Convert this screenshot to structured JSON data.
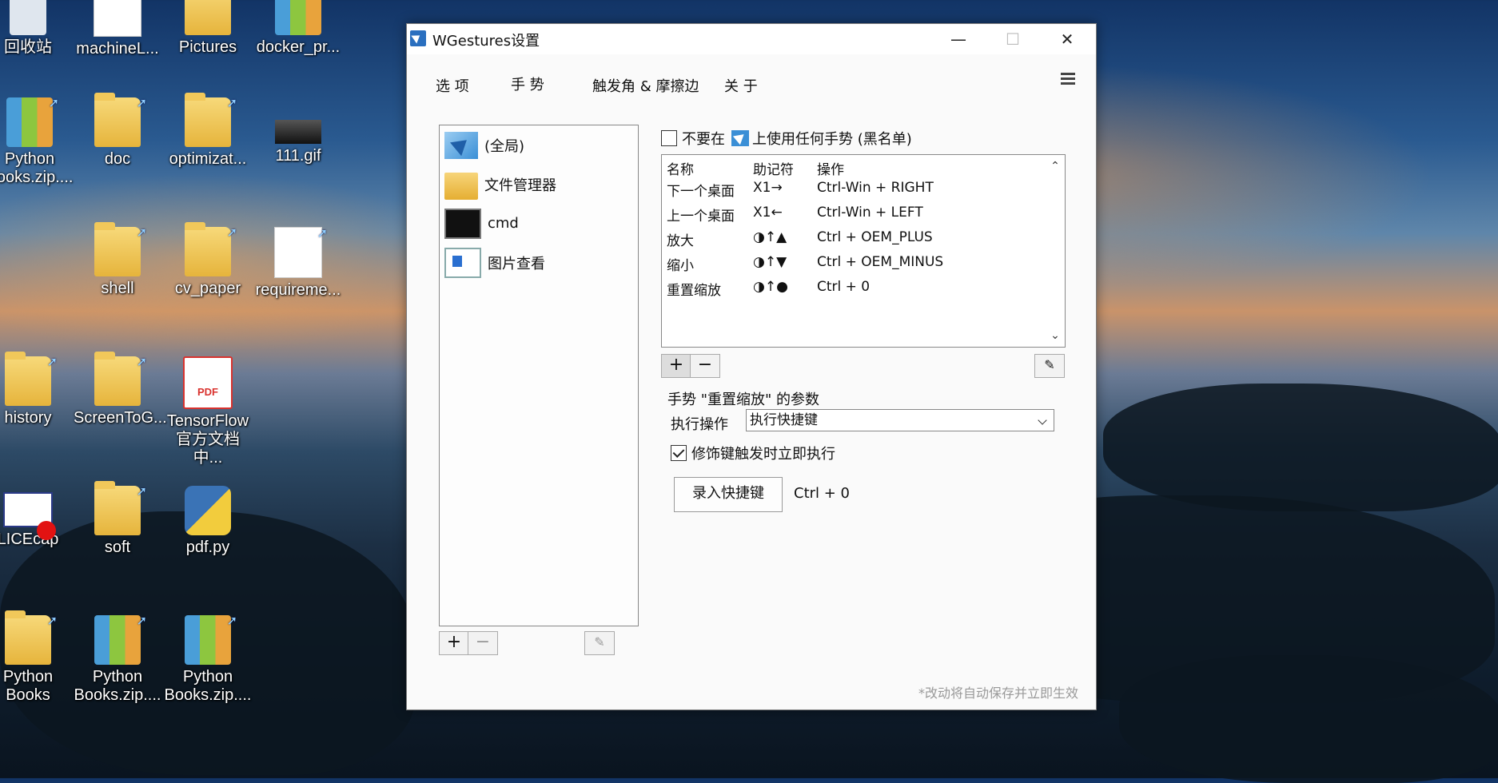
{
  "desktop": {
    "icons": [
      {
        "label": "回收站"
      },
      {
        "label": "machineL..."
      },
      {
        "label": "Pictures"
      },
      {
        "label": "docker_pr..."
      },
      {
        "label": "Python Books.zip...."
      },
      {
        "label": "doc"
      },
      {
        "label": "optimizat..."
      },
      {
        "label": "111.gif"
      },
      {
        "label": "shell"
      },
      {
        "label": "cv_paper"
      },
      {
        "label": "requireme..."
      },
      {
        "label": "history"
      },
      {
        "label": "ScreenToG..."
      },
      {
        "label": "TensorFlow 官方文档中..."
      },
      {
        "label": "LICEcap"
      },
      {
        "label": "soft"
      },
      {
        "label": "pdf.py"
      },
      {
        "label": "Python Books"
      },
      {
        "label": "Python Books.zip...."
      },
      {
        "label": "Python Books.zip...."
      }
    ]
  },
  "window": {
    "title": "WGestures设置",
    "controls": {
      "minimize": "—",
      "maximize": "☐",
      "close": "✕"
    },
    "tabs": [
      "选 项",
      "手 势",
      "触发角 & 摩擦边",
      "关 于"
    ],
    "app_list": [
      {
        "label": "(全局)"
      },
      {
        "label": "文件管理器"
      },
      {
        "label": "cmd"
      },
      {
        "label": "图片查看"
      }
    ],
    "list_buttons": {
      "add": "+",
      "remove": "−"
    },
    "blacklist": {
      "prefix": "不要在",
      "suffix": "上使用任何手势 (黑名单)",
      "checked": false
    },
    "gesture_table": {
      "headers": [
        "名称",
        "助记符",
        "操作"
      ],
      "rows": [
        {
          "name": "下一个桌面",
          "mnemonic": "X1→",
          "action": "Ctrl-Win + RIGHT"
        },
        {
          "name": "上一个桌面",
          "mnemonic": "X1←",
          "action": "Ctrl-Win + LEFT"
        },
        {
          "name": "放大",
          "mnemonic": "◑↑▲",
          "action": "Ctrl + OEM_PLUS"
        },
        {
          "name": "缩小",
          "mnemonic": "◑↑▼",
          "action": "Ctrl + OEM_MINUS"
        },
        {
          "name": "重置缩放",
          "mnemonic": "◑↑●",
          "action": "Ctrl + 0"
        }
      ],
      "scroll_up": "⌃",
      "scroll_down": "⌄"
    },
    "gesture_buttons": {
      "add": "+",
      "remove": "−"
    },
    "params_title": "手势 \"重置缩放\" 的参数",
    "exec_label": "执行操作",
    "exec_value": "执行快捷键",
    "modifier_exec": {
      "label": "修饰键触发时立即执行",
      "checked": true
    },
    "record_button": "录入快捷键",
    "hotkey_value": "Ctrl + 0",
    "footer_note": "*改动将自动保存并立即生效"
  }
}
